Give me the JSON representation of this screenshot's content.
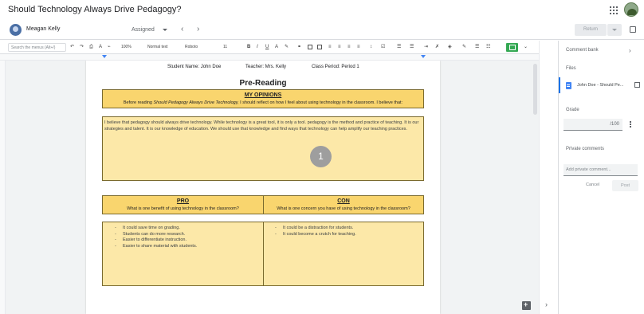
{
  "header": {
    "title": "Should Technology Always Drive Pedagogy?"
  },
  "student_bar": {
    "student_name": "Meagan Kelly",
    "status": "Assigned",
    "prev": "‹",
    "next": "›",
    "return_label": "Return"
  },
  "toolbar": {
    "search_placeholder": "Search the menus (Alt+/)",
    "zoom": "100%",
    "style": "Normal text",
    "font": "Roboto",
    "size": "11"
  },
  "document": {
    "student_line": "Student Name: John Doe",
    "teacher_line": "Teacher: Mrs. Kelly",
    "period_line": "Class Period: Period 1",
    "heading": "Pre-Reading",
    "opinions": {
      "title": "MY OPINIONS",
      "prompt_before": "Before reading ",
      "prompt_italic": "Should Pedagogy Always Drive Technology,",
      "prompt_after": " I should reflect on how I feel about using technology in the classroom.  I believe that:",
      "answer": "I believe that pedagogy should always drive technology. While technology is a great tool, it is only a tool. pedagogy is the method and practice of teaching. It is our strategies and talent. It is our knowledge of education. We should use that knowledge and find ways that technology can help amplify our teaching practices.",
      "badge": "1"
    },
    "pro": {
      "title": "PRO",
      "prompt": "What is one benefit of using technology in the classroom?",
      "items": [
        "It could save time on grading.",
        "Students can do more research.",
        "Easier to differentiate instruction.",
        "Easier to share material with students."
      ]
    },
    "con": {
      "title": "CON",
      "prompt": "What is one concern you have of using technology in the classroom?",
      "items": [
        "It could be a distraction for students.",
        "It could become a crutch for teaching."
      ]
    }
  },
  "side_panel": {
    "comment_bank": "Comment bank",
    "files_label": "Files",
    "file_name": "John Doe - Should Pe...",
    "grade_label": "Grade",
    "grade_value": "/100",
    "private_comments_label": "Private comments",
    "private_placeholder": "Add private comment...",
    "cancel_label": "Cancel",
    "post_label": "Post"
  },
  "colors": {
    "box_fill": "#fce8a8",
    "box_header_fill": "#f9d56e",
    "accent": "#1a73e8"
  }
}
